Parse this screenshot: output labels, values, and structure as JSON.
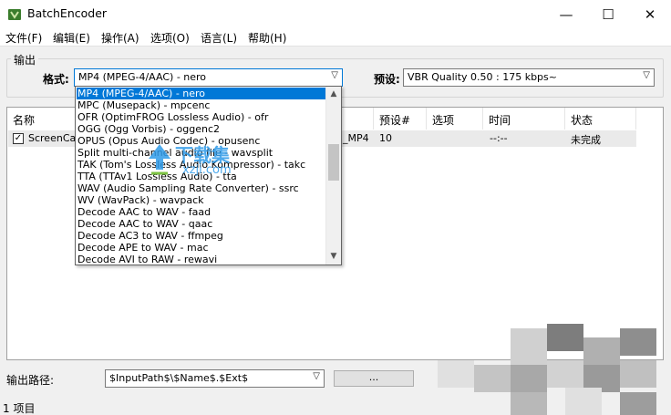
{
  "window": {
    "title": "BatchEncoder",
    "minimize": "—",
    "maximize": "☐",
    "close": "✕"
  },
  "menu": [
    "文件(F)",
    "编辑(E)",
    "操作(A)",
    "选项(O)",
    "语言(L)",
    "帮助(H)"
  ],
  "output_group": {
    "legend": "输出",
    "format_label": "格式:",
    "format_value": "MP4 (MPEG-4/AAC) - nero",
    "preset_label": "预设:",
    "preset_value": "VBR Quality 0.50 : 175 kbps~"
  },
  "list": {
    "columns": [
      "名称",
      "预设#",
      "选项",
      "时间",
      "状态"
    ],
    "rows": [
      {
        "name": "ScreenCap",
        "format": "_MP4",
        "preset": "10",
        "options": "",
        "time": "--:--",
        "status": "未完成",
        "checked": true
      }
    ]
  },
  "dropdown_options": [
    "MP4 (MPEG-4/AAC) - nero",
    "MPC (Musepack) - mpcenc",
    "OFR (OptimFROG Lossless Audio) - ofr",
    "OGG (Ogg Vorbis) - oggenc2",
    "OPUS (Opus Audio Codec) - opusenc",
    "Split multi-channel audio file - wavsplit",
    "TAK (Tom's Lossless Audio Kompressor) - takc",
    "TTA (TTAv1 Lossless Audio) - tta",
    "WAV (Audio Sampling Rate Converter) - ssrc",
    "WV (WavPack) - wavpack",
    "Decode AAC to WAV - faad",
    "Decode AAC to WAV - qaac",
    "Decode AC3 to WAV - ffmpeg",
    "Decode APE to WAV - mac",
    "Decode AVI to RAW - rewavi"
  ],
  "output_path": {
    "label": "输出路径:",
    "value": "$InputPath$\\$Name$.$Ext$",
    "browse": "..."
  },
  "status_bar": "1 项目",
  "watermark": {
    "text": "下载集",
    "sub": "xzji.com"
  },
  "colors": {
    "selection": "#0078d7",
    "watermark": "#2f9be9"
  }
}
